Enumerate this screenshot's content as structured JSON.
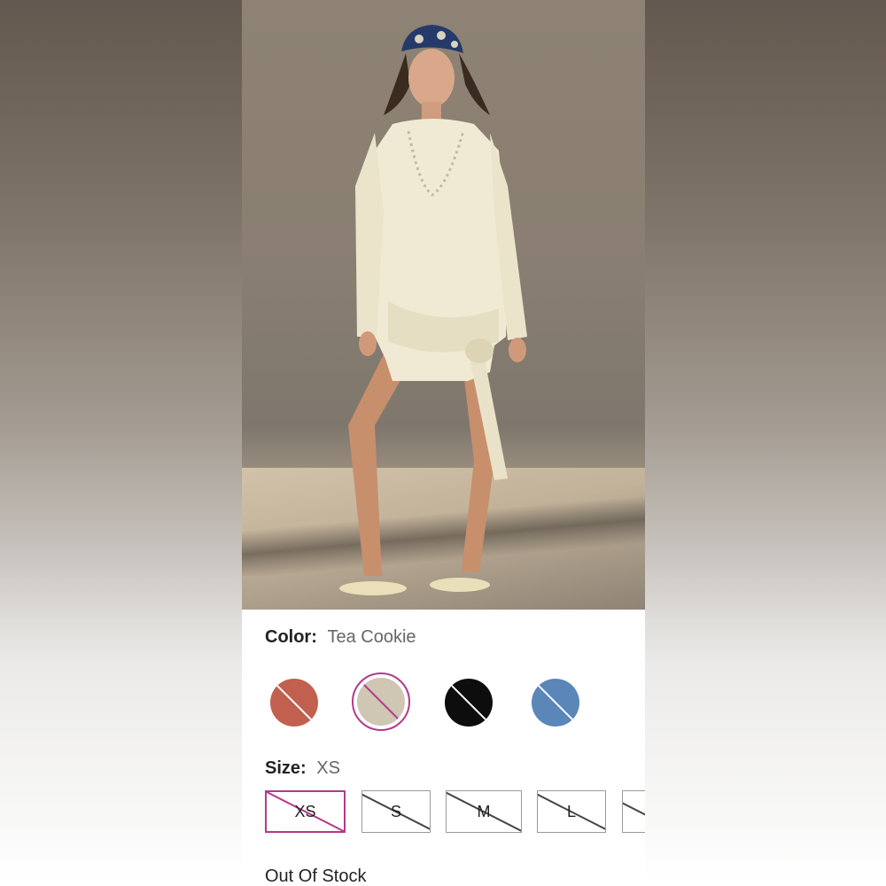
{
  "product": {
    "image_alt": "Model wearing cream knit tie-front sweater dress"
  },
  "color": {
    "label": "Color:",
    "selected": "Tea Cookie",
    "swatches": [
      {
        "name": "terracotta",
        "hex": "#c2604f",
        "available": false
      },
      {
        "name": "tea-cookie",
        "hex": "#cfc6b4",
        "available": false,
        "selected": true
      },
      {
        "name": "black",
        "hex": "#0d0d0d",
        "available": false
      },
      {
        "name": "blue",
        "hex": "#5b86b8",
        "available": false
      }
    ]
  },
  "size": {
    "label": "Size:",
    "selected": "XS",
    "options": [
      {
        "label": "XS",
        "available": false,
        "selected": true
      },
      {
        "label": "S",
        "available": false
      },
      {
        "label": "M",
        "available": false
      },
      {
        "label": "L",
        "available": false
      },
      {
        "label": "",
        "available": false
      }
    ]
  },
  "stock_status": "Out Of Stock",
  "accent_color": "#b23a8a"
}
